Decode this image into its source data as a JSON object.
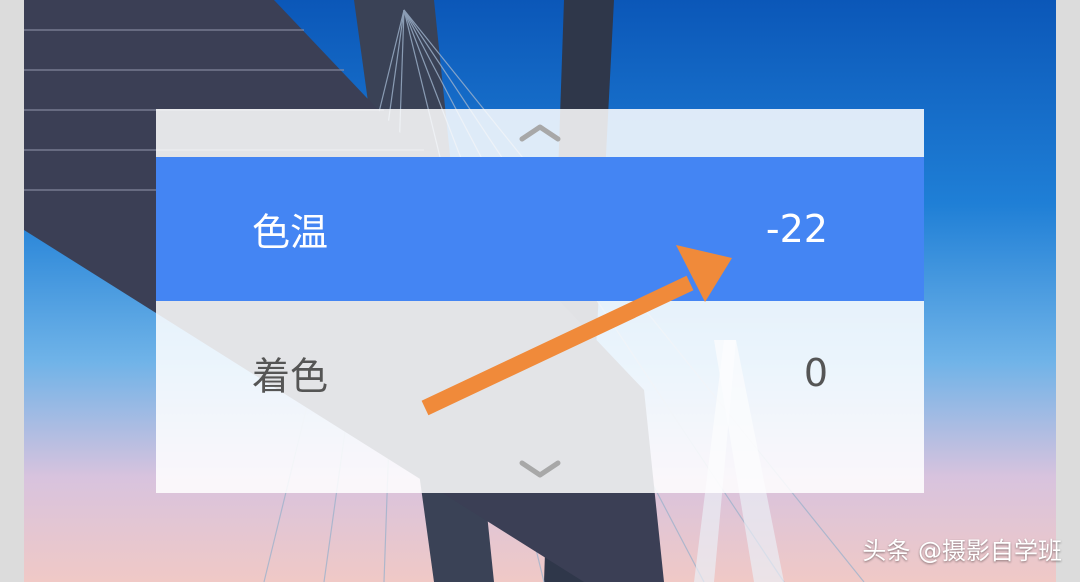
{
  "settings_list": {
    "rows": [
      {
        "label": "色温",
        "value": "-22"
      },
      {
        "label": "着色",
        "value": "0"
      }
    ],
    "selected_index": 0,
    "scroll_up_icon": "chevron-up-icon",
    "scroll_down_icon": "chevron-down-icon"
  },
  "annotation": {
    "icon": "annotation-arrow-icon",
    "color": "#f08a3a"
  },
  "watermark": {
    "text": "头条 @摄影自学班"
  },
  "colors": {
    "selected_row": "#4485f3",
    "accent_arrow": "#f08a3a"
  }
}
